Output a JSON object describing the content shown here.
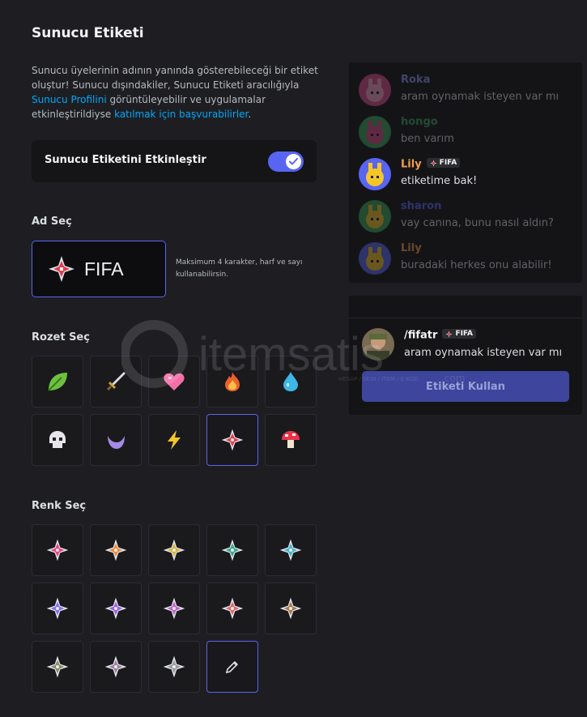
{
  "page": {
    "title": "Sunucu Etiketi",
    "description": {
      "part1": "Sunucu üyelerinin adının yanında gösterebileceği bir etiket oluştur! Sunucu dışındakiler, Sunucu Etiketi aracılığıyla ",
      "link1": "Sunucu Profilini",
      "part2": " görüntüleyebilir ve uygulamalar etkinleştirildiyse ",
      "link2": "katılmak için başvurabilirler",
      "part3": "."
    }
  },
  "toggle": {
    "label": "Sunucu Etiketini Etkinleştir",
    "enabled": true
  },
  "name_section": {
    "label": "Ad Seç",
    "value": "FIFA",
    "hint": "Maksimum 4 karakter, harf ve sayı kullanabilirsin."
  },
  "badge_section": {
    "label": "Rozet Seç",
    "badges": [
      "leaf-icon",
      "sword-icon",
      "heart-icon",
      "fire-icon",
      "water-drop-icon",
      "skull-icon",
      "moon-icon",
      "lightning-icon",
      "diamond-star-icon",
      "mushroom-icon"
    ],
    "selected_index": 8
  },
  "color_section": {
    "label": "Renk Seç",
    "colors": [
      "#e8457a",
      "#f08a3c",
      "#d9b23a",
      "#3aa68a",
      "#4db3c9",
      "#8b6fe8",
      "#9c5fe0",
      "#c261c9",
      "#e06a6a",
      "#a87a4a",
      "#8a8a66",
      "#a0809a",
      "#9a9a9a"
    ],
    "custom_picker_icon": "eyedropper-icon"
  },
  "preview": {
    "messages": [
      {
        "user": "Roka",
        "text": "aram oynamak isteyen var mı",
        "tag": null,
        "avatar": "pink-avatar",
        "dim": true,
        "color": "#8d91f0"
      },
      {
        "user": "hongo",
        "text": "ben varım",
        "tag": null,
        "avatar": "green-avatar",
        "dim": true,
        "color": "#3ba55c"
      },
      {
        "user": "Lily",
        "text": "etiketime bak!",
        "tag": "FIFA",
        "avatar": "yellow-bunny-avatar",
        "dim": false,
        "color": "#f0a050"
      },
      {
        "user": "sharon",
        "text": "vay canına, bunu nasıl aldın?",
        "tag": null,
        "avatar": "green-yellow-avatar",
        "dim": true,
        "color": "#5865f2"
      },
      {
        "user": "Lily",
        "text": "buradaki herkes onu alabilir!",
        "tag": null,
        "avatar": "yellow-bunny-avatar",
        "dim": true,
        "color": "#f0a050"
      }
    ]
  },
  "card": {
    "user": "/fifatr",
    "tag": "FIFA",
    "text": "aram oynamak isteyen var mı",
    "button": "Etiketi Kullan"
  },
  "watermark": {
    "text": "itemsatis",
    "subtitle": "HESAP / SKIN / ITEM / E-KOD",
    "suffix": ".com"
  }
}
